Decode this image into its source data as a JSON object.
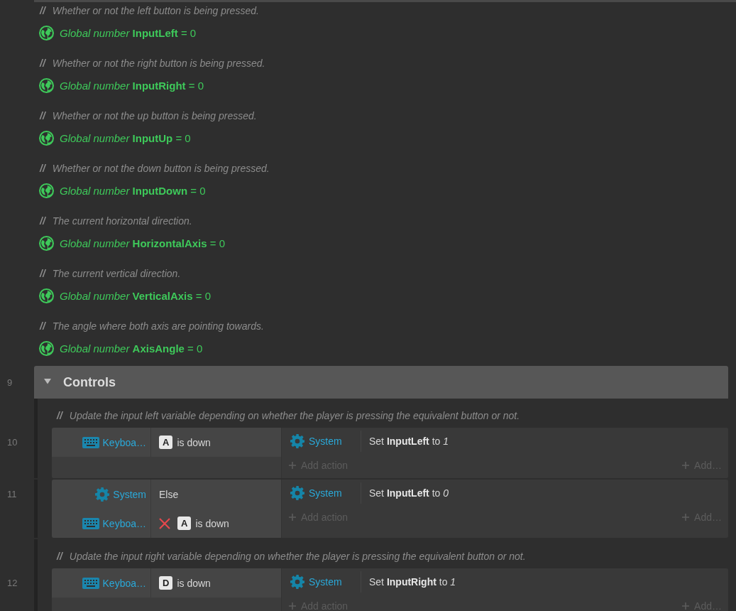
{
  "variables": [
    {
      "comment_marker": "//",
      "comment": "Whether or not the left button is being pressed.",
      "declaration": "*Global number* **InputLeft** = 0"
    },
    {
      "comment_marker": "//",
      "comment": "Whether or not the right button is being pressed.",
      "declaration": "*Global number* **InputRight** = 0"
    },
    {
      "comment_marker": "//",
      "comment": "Whether or not the up button is being pressed.",
      "declaration": "*Global number* **InputUp** = 0"
    },
    {
      "comment_marker": "//",
      "comment": "Whether or not the down button is being pressed.",
      "declaration": "*Global number* **InputDown** = 0"
    },
    {
      "comment_marker": "//",
      "comment": "The current horizontal direction.",
      "declaration": "*Global number* **HorizontalAxis** = 0"
    },
    {
      "comment_marker": "//",
      "comment": "The current vertical direction.",
      "declaration": "*Global number* **VerticalAxis** = 0"
    },
    {
      "comment_marker": "//",
      "comment": "The angle where both axis are pointing towards.",
      "declaration": "*Global number* **AxisAngle** = 0"
    }
  ],
  "group": {
    "line": "9",
    "title": "Controls",
    "expanded": true,
    "items": [
      {
        "kind": "comment",
        "marker": "//",
        "text": "Update the input left variable depending on whether the player is pressing the equivalent button or not."
      },
      {
        "kind": "event",
        "line": "10",
        "conditions": [
          {
            "object": "Keyboa…",
            "kind": "keyboard",
            "key": "A",
            "text": "is down",
            "inverted": false
          }
        ],
        "actions": [
          {
            "object": "System",
            "kind": "system",
            "text": "Set **InputLeft** to *1*"
          }
        ],
        "add_action": "Add action",
        "add_more": "Add…"
      },
      {
        "kind": "event",
        "line": "11",
        "conditions": [
          {
            "object": "System",
            "kind": "system",
            "text": "Else",
            "inverted": false
          },
          {
            "object": "Keyboa…",
            "kind": "keyboard",
            "key": "A",
            "text": "is down",
            "inverted": true
          }
        ],
        "actions": [
          {
            "object": "System",
            "kind": "system",
            "text": "Set **InputLeft** to *0*"
          }
        ],
        "add_action": "Add action",
        "add_more": "Add…"
      },
      {
        "kind": "comment",
        "marker": "//",
        "text": "Update the input right variable depending on whether the player is pressing the equivalent button or not."
      },
      {
        "kind": "event",
        "line": "12",
        "conditions": [
          {
            "object": "Keyboa…",
            "kind": "keyboard",
            "key": "D",
            "text": "is down",
            "inverted": false
          }
        ],
        "actions": [
          {
            "object": "System",
            "kind": "system",
            "text": "Set **InputRight** to *1*"
          }
        ],
        "add_action": "Add action",
        "add_more": "Add…"
      }
    ]
  }
}
